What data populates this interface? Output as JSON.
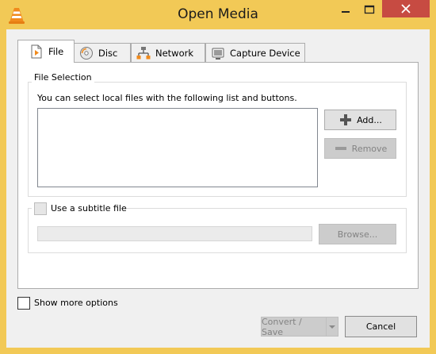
{
  "window": {
    "title": "Open Media"
  },
  "tabs": [
    {
      "label": "File",
      "icon": "file-icon",
      "active": true
    },
    {
      "label": "Disc",
      "icon": "disc-icon",
      "active": false
    },
    {
      "label": "Network",
      "icon": "network-icon",
      "active": false
    },
    {
      "label": "Capture Device",
      "icon": "capture-device-icon",
      "active": false
    }
  ],
  "file_selection": {
    "title": "File Selection",
    "description": "You can select local files with the following list and buttons.",
    "add_label": "Add...",
    "remove_label": "Remove",
    "remove_enabled": false,
    "files": []
  },
  "subtitle": {
    "checkbox_label": "Use a subtitle file",
    "checked": false,
    "path_value": "",
    "browse_label": "Browse...",
    "enabled": false
  },
  "footer": {
    "show_more_label": "Show more options",
    "show_more_checked": false,
    "convert_label": "Convert / Save",
    "convert_enabled": false,
    "cancel_label": "Cancel"
  },
  "colors": {
    "frame": "#f2c956",
    "close_button": "#c74b42",
    "disabled_button": "#cccccc"
  }
}
